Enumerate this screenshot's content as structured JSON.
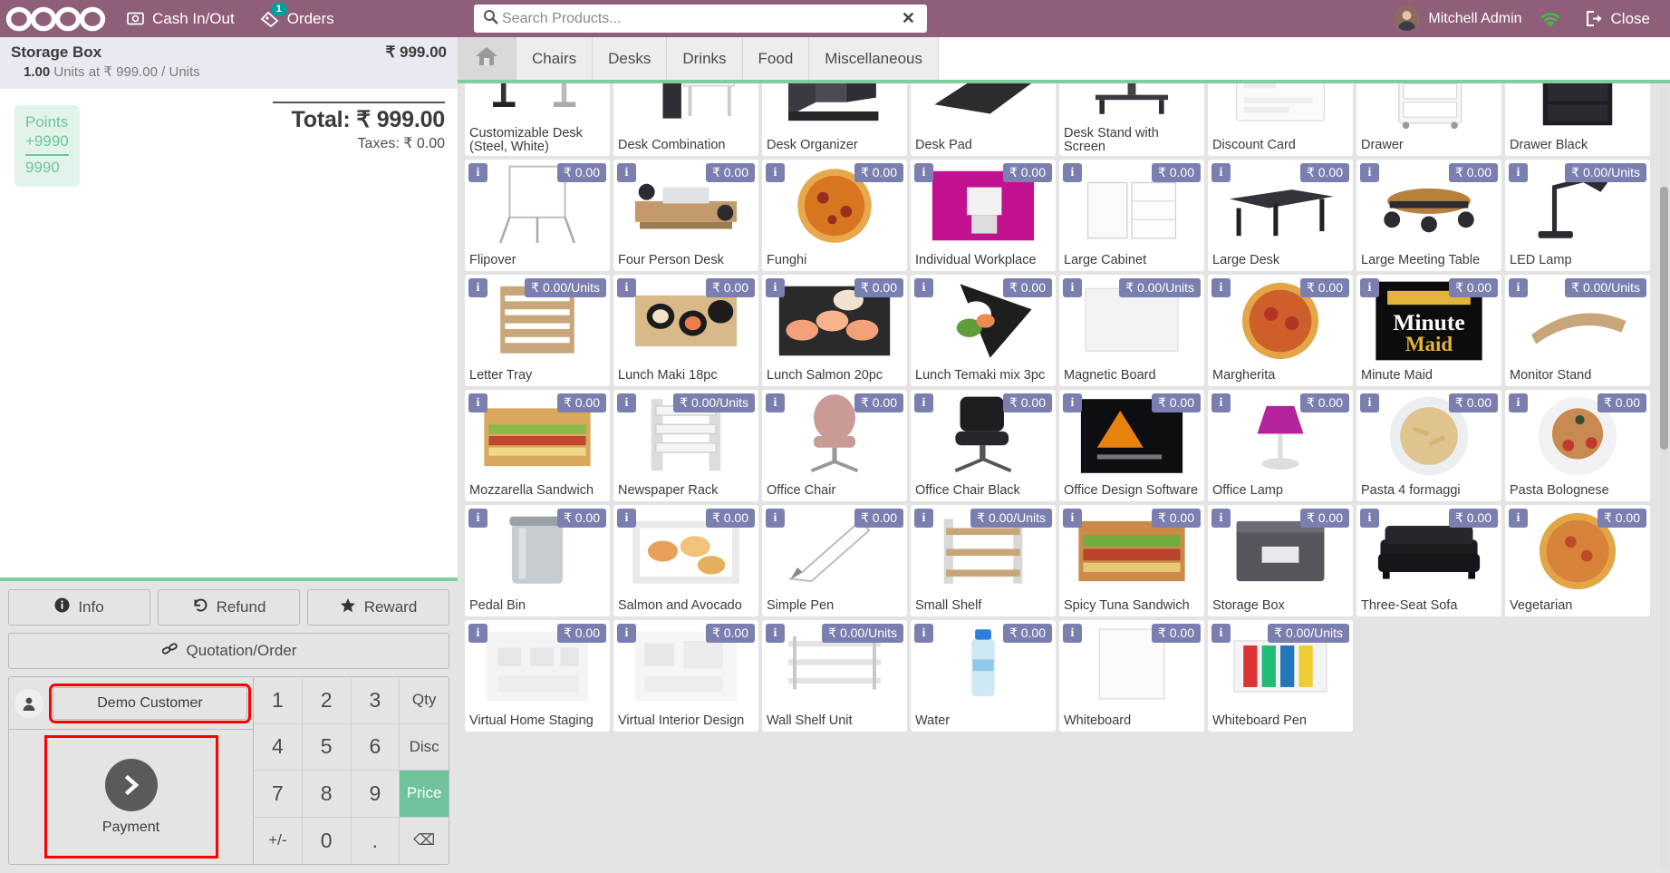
{
  "topbar": {
    "brand": "odoo",
    "cash_in_out": "Cash In/Out",
    "cash_icon": "cash-register-icon",
    "orders": "Orders",
    "orders_icon": "ticket-icon",
    "orders_count": "1",
    "search_placeholder": "Search Products...",
    "search_value": "",
    "search_icon": "search-icon",
    "clear_icon": "close-icon",
    "user": "Mitchell Admin",
    "avatar": "user-avatar",
    "wifi_icon": "wifi-icon",
    "close": "Close",
    "close_icon": "logout-icon",
    "brand_color": "#8f5f79",
    "accent_color": "#7fce9f"
  },
  "order": {
    "lines": [
      {
        "name": "Storage Box",
        "price": "₹ 999.00",
        "qty": "1.00",
        "detail": " Units at ₹ 999.00 / Units"
      }
    ],
    "reward": {
      "label": "Points",
      "delta": "+9990",
      "total": "9990"
    },
    "total_label": "Total: ₹ 999.00",
    "taxes_label": "Taxes: ₹ 0.00"
  },
  "controls": {
    "info": "Info",
    "info_icon": "info-icon",
    "refund": "Refund",
    "refund_icon": "undo-icon",
    "reward": "Reward",
    "reward_icon": "star-icon",
    "quotation": "Quotation/Order",
    "quotation_icon": "link-icon"
  },
  "numpad": {
    "customer": "Demo Customer",
    "customer_icon": "person-icon",
    "payment": "Payment",
    "payment_icon": "chevron-right-icon",
    "keys": [
      {
        "label": "1",
        "active": false
      },
      {
        "label": "2",
        "active": false
      },
      {
        "label": "3",
        "active": false
      },
      {
        "label": "Qty",
        "active": false,
        "small": true
      },
      {
        "label": "4",
        "active": false
      },
      {
        "label": "5",
        "active": false
      },
      {
        "label": "6",
        "active": false
      },
      {
        "label": "Disc",
        "active": false,
        "small": true
      },
      {
        "label": "7",
        "active": false
      },
      {
        "label": "8",
        "active": false
      },
      {
        "label": "9",
        "active": false
      },
      {
        "label": "Price",
        "active": true,
        "small": true
      },
      {
        "label": "+/-",
        "active": false,
        "small": true
      },
      {
        "label": "0",
        "active": false
      },
      {
        "label": ".",
        "active": false
      },
      {
        "label": "⌫",
        "active": false,
        "small": true
      }
    ]
  },
  "categories": [
    {
      "label": "",
      "icon": "home-icon",
      "home": true
    },
    {
      "label": "Chairs",
      "icon": ""
    },
    {
      "label": "Desks",
      "icon": ""
    },
    {
      "label": "Drinks",
      "icon": ""
    },
    {
      "label": "Food",
      "icon": ""
    },
    {
      "label": "Miscellaneous",
      "icon": ""
    }
  ],
  "products": [
    {
      "name": "Customizable Desk (Steel, White)",
      "price": "",
      "info": false,
      "art": "desk-white"
    },
    {
      "name": "Desk Combination",
      "price": "",
      "info": false,
      "art": "desk-combo"
    },
    {
      "name": "Desk Organizer",
      "price": "",
      "info": false,
      "art": "organizer"
    },
    {
      "name": "Desk Pad",
      "price": "",
      "info": false,
      "art": "deskpad"
    },
    {
      "name": "Desk Stand with Screen",
      "price": "",
      "info": false,
      "art": "deskstand"
    },
    {
      "name": "Discount Card",
      "price": "",
      "info": false,
      "art": "card"
    },
    {
      "name": "Drawer",
      "price": "",
      "info": false,
      "art": "drawer"
    },
    {
      "name": "Drawer Black",
      "price": "",
      "info": false,
      "art": "drawerblack"
    },
    {
      "name": "Flipover",
      "price": "₹ 0.00",
      "info": true,
      "art": "flipover"
    },
    {
      "name": "Four Person Desk",
      "price": "₹ 0.00",
      "info": true,
      "art": "fourdesk"
    },
    {
      "name": "Funghi",
      "price": "₹ 0.00",
      "info": true,
      "art": "pizza"
    },
    {
      "name": "Individual Workplace",
      "price": "₹ 0.00",
      "info": true,
      "art": "magenta"
    },
    {
      "name": "Large Cabinet",
      "price": "₹ 0.00",
      "info": true,
      "art": "cabinet"
    },
    {
      "name": "Large Desk",
      "price": "₹ 0.00",
      "info": true,
      "art": "largedesk"
    },
    {
      "name": "Large Meeting Table",
      "price": "₹ 0.00",
      "info": true,
      "art": "meeting"
    },
    {
      "name": "LED Lamp",
      "price": "₹ 0.00/Units",
      "info": true,
      "art": "ledlamp"
    },
    {
      "name": "Letter Tray",
      "price": "₹ 0.00/Units",
      "info": true,
      "art": "lettertray"
    },
    {
      "name": "Lunch Maki 18pc",
      "price": "₹ 0.00",
      "info": true,
      "art": "maki"
    },
    {
      "name": "Lunch Salmon 20pc",
      "price": "₹ 0.00",
      "info": true,
      "art": "salmon"
    },
    {
      "name": "Lunch Temaki mix 3pc",
      "price": "₹ 0.00",
      "info": true,
      "art": "temaki"
    },
    {
      "name": "Magnetic Board",
      "price": "₹ 0.00/Units",
      "info": true,
      "art": "magnetic"
    },
    {
      "name": "Margherita",
      "price": "₹ 0.00",
      "info": true,
      "art": "pizza2"
    },
    {
      "name": "Minute Maid",
      "price": "₹ 0.00",
      "info": true,
      "art": "minutemaid"
    },
    {
      "name": "Monitor Stand",
      "price": "₹ 0.00/Units",
      "info": true,
      "art": "monitorstand"
    },
    {
      "name": "Mozzarella Sandwich",
      "price": "₹ 0.00",
      "info": true,
      "art": "sandwich"
    },
    {
      "name": "Newspaper Rack",
      "price": "₹ 0.00/Units",
      "info": true,
      "art": "newsrack"
    },
    {
      "name": "Office Chair",
      "price": "₹ 0.00",
      "info": true,
      "art": "officechair"
    },
    {
      "name": "Office Chair Black",
      "price": "₹ 0.00",
      "info": true,
      "art": "chairblack"
    },
    {
      "name": "Office Design Software",
      "price": "₹ 0.00",
      "info": true,
      "art": "software"
    },
    {
      "name": "Office Lamp",
      "price": "₹ 0.00",
      "info": true,
      "art": "officelamp"
    },
    {
      "name": "Pasta 4 formaggi",
      "price": "₹ 0.00",
      "info": true,
      "art": "pasta1"
    },
    {
      "name": "Pasta Bolognese",
      "price": "₹ 0.00",
      "info": true,
      "art": "pasta2"
    },
    {
      "name": "Pedal Bin",
      "price": "₹ 0.00",
      "info": true,
      "art": "pedalbin"
    },
    {
      "name": "Salmon and Avocado",
      "price": "₹ 0.00",
      "info": true,
      "art": "salmonavo"
    },
    {
      "name": "Simple Pen",
      "price": "₹ 0.00",
      "info": true,
      "art": "pen"
    },
    {
      "name": "Small Shelf",
      "price": "₹ 0.00/Units",
      "info": true,
      "art": "smallshelf"
    },
    {
      "name": "Spicy Tuna Sandwich",
      "price": "₹ 0.00",
      "info": true,
      "art": "tuna"
    },
    {
      "name": "Storage Box",
      "price": "₹ 0.00",
      "info": true,
      "art": "storagebox"
    },
    {
      "name": "Three-Seat Sofa",
      "price": "₹ 0.00",
      "info": true,
      "art": "sofa"
    },
    {
      "name": "Vegetarian",
      "price": "₹ 0.00",
      "info": true,
      "art": "pizza3"
    },
    {
      "name": "Virtual Home Staging",
      "price": "₹ 0.00",
      "info": true,
      "art": "staging"
    },
    {
      "name": "Virtual Interior Design",
      "price": "₹ 0.00",
      "info": true,
      "art": "interior"
    },
    {
      "name": "Wall Shelf Unit",
      "price": "₹ 0.00/Units",
      "info": true,
      "art": "wallshelf"
    },
    {
      "name": "Water",
      "price": "₹ 0.00",
      "info": true,
      "art": "water"
    },
    {
      "name": "Whiteboard",
      "price": "₹ 0.00",
      "info": true,
      "art": "whiteboard"
    },
    {
      "name": "Whiteboard Pen",
      "price": "₹ 0.00/Units",
      "info": true,
      "art": "wbpen"
    }
  ]
}
